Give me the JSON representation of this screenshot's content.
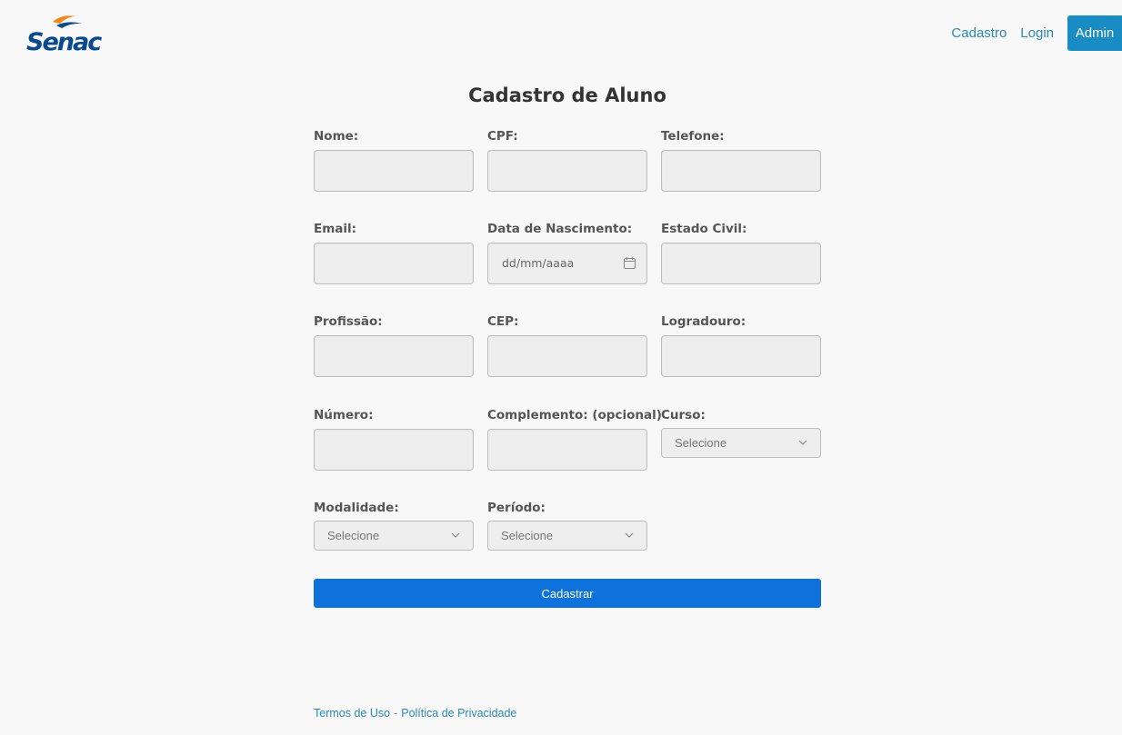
{
  "brand": {
    "logo_text": "Senac",
    "colors": {
      "logo_blue": "#0a4a8a",
      "logo_orange": "#f08a1c"
    }
  },
  "nav": {
    "items": [
      "Cadastro",
      "Login"
    ],
    "admin_label": "Admin"
  },
  "page": {
    "title": "Cadastro de Aluno"
  },
  "form": {
    "labels": {
      "nome": "Nome:",
      "cpf": "CPF:",
      "telefone": "Telefone:",
      "email": "Email:",
      "nascimento": "Data de Nascimento:",
      "estado_civil": "Estado Civil:",
      "profissao": "Profissão:",
      "cep": "CEP:",
      "logradouro": "Logradouro:",
      "numero": "Número:",
      "complemento": "Complemento: (opcional)",
      "curso": "Curso:",
      "modalidade": "Modalidade:",
      "periodo": "Período:"
    },
    "nascimento_placeholder": "dd/mm/aaaa",
    "select_placeholder": "Selecione",
    "submit_label": "Cadastrar"
  },
  "footer": {
    "terms": "Termos de Uso",
    "separator": "-",
    "privacy": "Política de Privacidade"
  },
  "colors": {
    "accent": "#1a8cc4",
    "submit": "#0d72dc",
    "link": "#2a88b6"
  }
}
